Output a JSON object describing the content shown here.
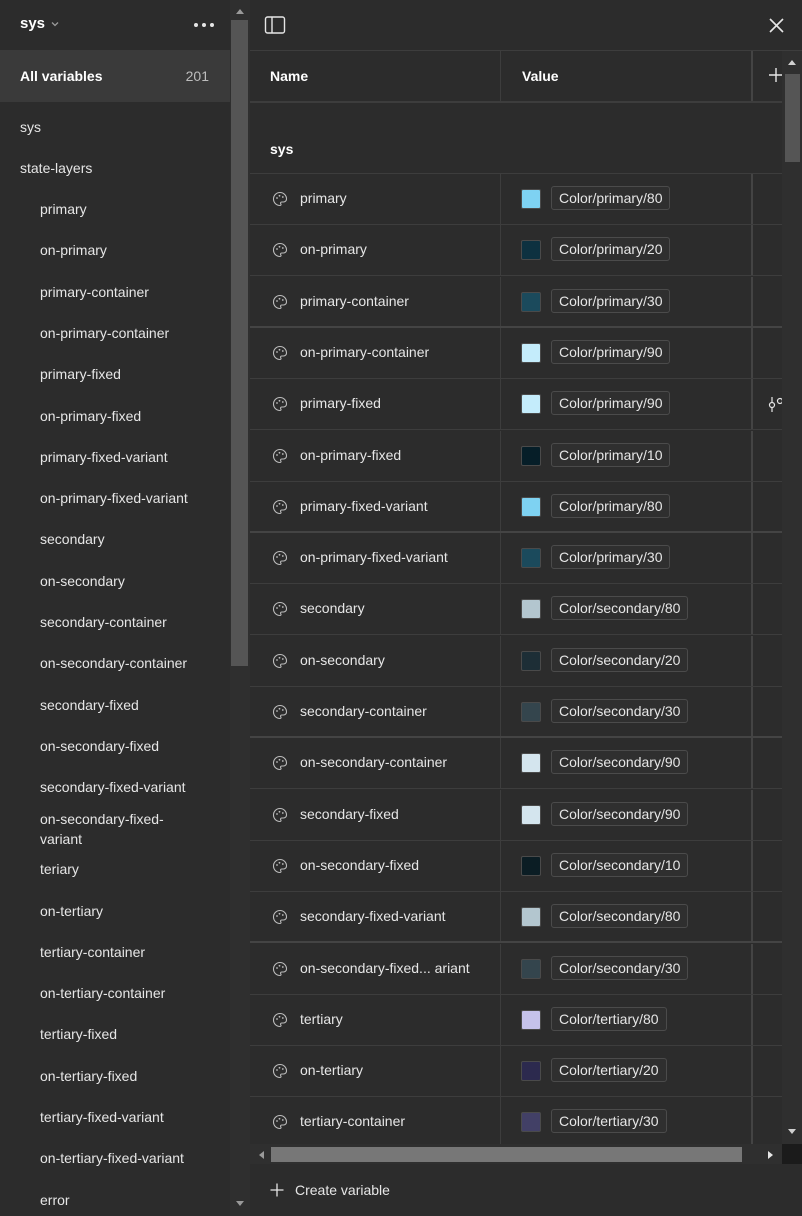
{
  "sidebar": {
    "collection": "sys",
    "all_variables": {
      "label": "All variables",
      "count": "201"
    },
    "groups": [
      {
        "label": "sys",
        "level": 0
      },
      {
        "label": "state-layers",
        "level": 0
      }
    ],
    "items": [
      "primary",
      "on-primary",
      "primary-container",
      "on-primary-container",
      "primary-fixed",
      "on-primary-fixed",
      "primary-fixed-variant",
      "on-primary-fixed-variant",
      "secondary",
      "on-secondary",
      "secondary-container",
      "on-secondary-container",
      "secondary-fixed",
      "on-secondary-fixed",
      "secondary-fixed-variant",
      "on-secondary-fixed-variant",
      "teriary",
      "on-tertiary",
      "tertiary-container",
      "on-tertiary-container",
      "tertiary-fixed",
      "on-tertiary-fixed",
      "tertiary-fixed-variant",
      "on-tertiary-fixed-variant",
      "error"
    ]
  },
  "table": {
    "headers": {
      "name": "Name",
      "value": "Value"
    },
    "group_title": "sys",
    "rows": [
      {
        "name": "primary",
        "alias": "Color/primary/80",
        "swatch": "#7ed2f2"
      },
      {
        "name": "on-primary",
        "alias": "Color/primary/20",
        "swatch": "#0d3140"
      },
      {
        "name": "primary-container",
        "alias": "Color/primary/30",
        "swatch": "#1b4a5c"
      },
      {
        "name": "on-primary-container",
        "alias": "Color/primary/90",
        "swatch": "#c4ecfb"
      },
      {
        "name": "primary-fixed",
        "alias": "Color/primary/90",
        "swatch": "#c4ecfb"
      },
      {
        "name": "on-primary-fixed",
        "alias": "Color/primary/10",
        "swatch": "#061e28"
      },
      {
        "name": "primary-fixed-variant",
        "alias": "Color/primary/80",
        "swatch": "#7ed2f2"
      },
      {
        "name": "on-primary-fixed-variant",
        "alias": "Color/primary/30",
        "swatch": "#1b4a5c"
      },
      {
        "name": "secondary",
        "alias": "Color/secondary/80",
        "swatch": "#b3c6cf"
      },
      {
        "name": "on-secondary",
        "alias": "Color/secondary/20",
        "swatch": "#1d2e36"
      },
      {
        "name": "secondary-container",
        "alias": "Color/secondary/30",
        "swatch": "#34454d"
      },
      {
        "name": "on-secondary-container",
        "alias": "Color/secondary/90",
        "swatch": "#d4e5ee"
      },
      {
        "name": "secondary-fixed",
        "alias": "Color/secondary/90",
        "swatch": "#d4e5ee"
      },
      {
        "name": "on-secondary-fixed",
        "alias": "Color/secondary/10",
        "swatch": "#0b1d24"
      },
      {
        "name": "secondary-fixed-variant",
        "alias": "Color/secondary/80",
        "swatch": "#b3c6cf"
      },
      {
        "name": "on-secondary-fixed... ariant",
        "alias": "Color/secondary/30",
        "swatch": "#34454d"
      },
      {
        "name": "tertiary",
        "alias": "Color/tertiary/80",
        "swatch": "#c5c2ea"
      },
      {
        "name": "on-tertiary",
        "alias": "Color/tertiary/20",
        "swatch": "#2c2a4e"
      },
      {
        "name": "tertiary-container",
        "alias": "Color/tertiary/30",
        "swatch": "#424066"
      }
    ]
  },
  "footer": {
    "create_label": "Create variable"
  }
}
